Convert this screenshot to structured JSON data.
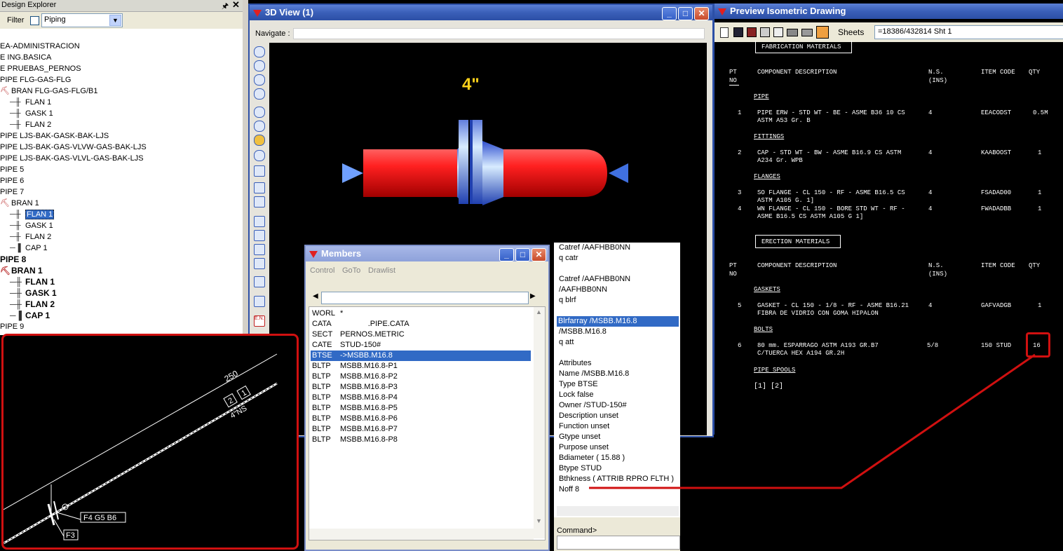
{
  "design_explorer": {
    "title": "Design Explorer",
    "filter_label": "Filter",
    "filter_value": "Piping",
    "items": [
      {
        "label": "EA-ADMINISTRACION",
        "indent": 0,
        "icon": "none"
      },
      {
        "label": "E ING.BASICA",
        "indent": 0,
        "icon": "none"
      },
      {
        "label": "E PRUEBAS_PERNOS",
        "indent": 0,
        "icon": "none"
      },
      {
        "label": "PIPE FLG-GAS-FLG",
        "indent": 0,
        "icon": "none"
      },
      {
        "label": "BRAN FLG-GAS-FLG/B1",
        "indent": 1,
        "icon": "bran"
      },
      {
        "label": "FLAN 1",
        "indent": 2,
        "icon": "flan"
      },
      {
        "label": "GASK 1",
        "indent": 2,
        "icon": "flan"
      },
      {
        "label": "FLAN 2",
        "indent": 2,
        "icon": "flan"
      },
      {
        "label": "PIPE LJS-BAK-GASK-BAK-LJS",
        "indent": 0,
        "icon": "none"
      },
      {
        "label": "PIPE LJS-BAK-GAS-VLVW-GAS-BAK-LJS",
        "indent": 0,
        "icon": "none"
      },
      {
        "label": "PIPE  LJS-BAK-GAS-VLVL-GAS-BAK-LJS",
        "indent": 0,
        "icon": "none"
      },
      {
        "label": "PIPE 5",
        "indent": 0,
        "icon": "none"
      },
      {
        "label": "PIPE 6",
        "indent": 0,
        "icon": "none"
      },
      {
        "label": "PIPE 7",
        "indent": 0,
        "icon": "none"
      },
      {
        "label": "BRAN 1",
        "indent": 1,
        "icon": "bran"
      },
      {
        "label": "FLAN 1",
        "indent": 2,
        "icon": "flan",
        "selected": true
      },
      {
        "label": "GASK 1",
        "indent": 2,
        "icon": "flan"
      },
      {
        "label": "FLAN 2",
        "indent": 2,
        "icon": "flan"
      },
      {
        "label": "CAP 1",
        "indent": 2,
        "icon": "cap"
      },
      {
        "label": "PIPE 8",
        "indent": 0,
        "icon": "none",
        "bold": true
      },
      {
        "label": "BRAN 1",
        "indent": 1,
        "icon": "bran",
        "bold": true
      },
      {
        "label": "FLAN 1",
        "indent": 2,
        "icon": "flan",
        "bold": true
      },
      {
        "label": "GASK 1",
        "indent": 2,
        "icon": "flan",
        "bold": true
      },
      {
        "label": "FLAN 2",
        "indent": 2,
        "icon": "flan",
        "bold": true
      },
      {
        "label": "CAP 1",
        "indent": 2,
        "icon": "cap",
        "bold": true
      },
      {
        "label": "PIPE 9",
        "indent": 0,
        "icon": "none"
      }
    ]
  },
  "view3d": {
    "title": "3D View (1)",
    "navigate_label": "Navigate :",
    "size_label": "4\""
  },
  "members": {
    "title": "Members",
    "menu": [
      "Control",
      "GoTo",
      "Drawlist"
    ],
    "rows": [
      {
        "type": "WORL",
        "name": "*"
      },
      {
        "type": "CATA",
        "name": "             .PIPE.CATA"
      },
      {
        "type": "SECT",
        "name": "PERNOS.METRIC"
      },
      {
        "type": "CATE",
        "name": "STUD-150#"
      },
      {
        "type": "BTSE",
        "name": "->MSBB.M16.8",
        "selected": true
      },
      {
        "type": "BLTP",
        "name": "MSBB.M16.8-P1"
      },
      {
        "type": "BLTP",
        "name": "MSBB.M16.8-P2"
      },
      {
        "type": "BLTP",
        "name": "MSBB.M16.8-P3"
      },
      {
        "type": "BLTP",
        "name": "MSBB.M16.8-P4"
      },
      {
        "type": "BLTP",
        "name": "MSBB.M16.8-P5"
      },
      {
        "type": "BLTP",
        "name": "MSBB.M16.8-P6"
      },
      {
        "type": "BLTP",
        "name": "MSBB.M16.8-P7"
      },
      {
        "type": "BLTP",
        "name": "MSBB.M16.8-P8"
      }
    ]
  },
  "command_output": {
    "lines": [
      {
        "text": "Catref /AAFHBB0NN",
        "gap": false
      },
      {
        "text": "q catr",
        "gap": false
      },
      {
        "text": "",
        "gap": true
      },
      {
        "text": "Catref /AAFHBB0NN",
        "gap": false
      },
      {
        "text": "/AAFHBB0NN",
        "gap": false
      },
      {
        "text": "q blrf",
        "gap": false
      },
      {
        "text": "",
        "gap": true
      },
      {
        "text": "Blrfarray /MSBB.M16.8",
        "gap": false,
        "selected": true
      },
      {
        "text": " /MSBB.M16.8",
        "gap": false
      },
      {
        "text": "q att",
        "gap": false
      },
      {
        "text": "",
        "gap": true
      },
      {
        "text": "Attributes",
        "gap": false
      },
      {
        "text": "Name /MSBB.M16.8",
        "gap": false
      },
      {
        "text": "Type BTSE",
        "gap": false
      },
      {
        "text": "Lock false",
        "gap": false
      },
      {
        "text": "Owner /STUD-150#",
        "gap": false
      },
      {
        "text": "Description unset",
        "gap": false
      },
      {
        "text": "Function unset",
        "gap": false
      },
      {
        "text": "Gtype unset",
        "gap": false
      },
      {
        "text": "Purpose unset",
        "gap": false
      },
      {
        "text": "Bdiameter ( 15.88 )",
        "gap": false
      },
      {
        "text": "Btype STUD",
        "gap": false
      },
      {
        "text": "Bthkness ( ATTRIB RPRO FLTH )",
        "gap": false
      },
      {
        "text": "Noff 8",
        "gap": false
      }
    ],
    "command_label": "Command>"
  },
  "preview": {
    "title": "Preview Isometric Drawing",
    "sheets_label": "Sheets",
    "sheets_value": "=18386/432814 Sht 1",
    "fabrication_header": "FABRICATION MATERIALS",
    "erection_header": "ERECTION MATERIALS",
    "col_pt": "PT",
    "col_no": "NO",
    "col_desc": "COMPONENT DESCRIPTION",
    "col_ns": "N.S.",
    "col_ins": "(INS)",
    "col_code": "ITEM CODE",
    "col_qty": "QTY",
    "groups": {
      "pipe": "PIPE",
      "fittings": "FITTINGS",
      "flanges": "FLANGES",
      "gaskets": "GASKETS",
      "bolts": "BOLTS",
      "spools": "PIPE SPOOLS"
    },
    "spools_value": "[1] [2]",
    "rows": {
      "r1": {
        "pt": "1",
        "d1": "PIPE ERW - STD WT - BE - ASME B36 10 CS",
        "d2": "ASTM A53 Gr. B",
        "ns": "4",
        "code": "EEACODST",
        "qty": "0.5M"
      },
      "r2": {
        "pt": "2",
        "d1": "CAP - STD WT - BW - ASME B16.9 CS ASTM",
        "d2": "A234 Gr. WPB",
        "ns": "4",
        "code": "KAABOOST",
        "qty": "1"
      },
      "r3": {
        "pt": "3",
        "d1": "SO FLANGE - CL 150 - RF - ASME B16.5 CS",
        "d2": "ASTM A105 G. 1]",
        "ns": "4",
        "code": "FSADAD00",
        "qty": "1"
      },
      "r4": {
        "pt": "4",
        "d1": "WN FLANGE - CL 150 - BORE STD WT - RF -",
        "d2": "ASME B16.5 CS ASTM A105 G  1]",
        "ns": "4",
        "code": "FWADADBB",
        "qty": "1"
      },
      "r5": {
        "pt": "5",
        "d1": "GASKET - CL 150 - 1/8 - RF - ASME B16.21",
        "d2": "FIBRA DE VIDRIO CON GOMA HIPALON",
        "ns": "4",
        "code": "GAFVADGB",
        "qty": "1"
      },
      "r6": {
        "pt": "6",
        "d1": "80 mm. ESPARRAGO ASTM A193 GR.B7",
        "d2": "C/TUERCA HEX A194 GR.2H",
        "ns": "5/8",
        "code": "150 STUD",
        "qty": "16"
      }
    }
  },
  "iso_detail": {
    "dim": "250",
    "tag1": "1",
    "tag2": "2",
    "size": "4\"NS",
    "label1": "F4  G5  B6",
    "label2": "F3"
  },
  "colors": {
    "highlight_red": "#d01010",
    "selection_blue": "#316ac5",
    "pipe_red": "#e01818",
    "flange_blue": "#6fa0ff"
  }
}
